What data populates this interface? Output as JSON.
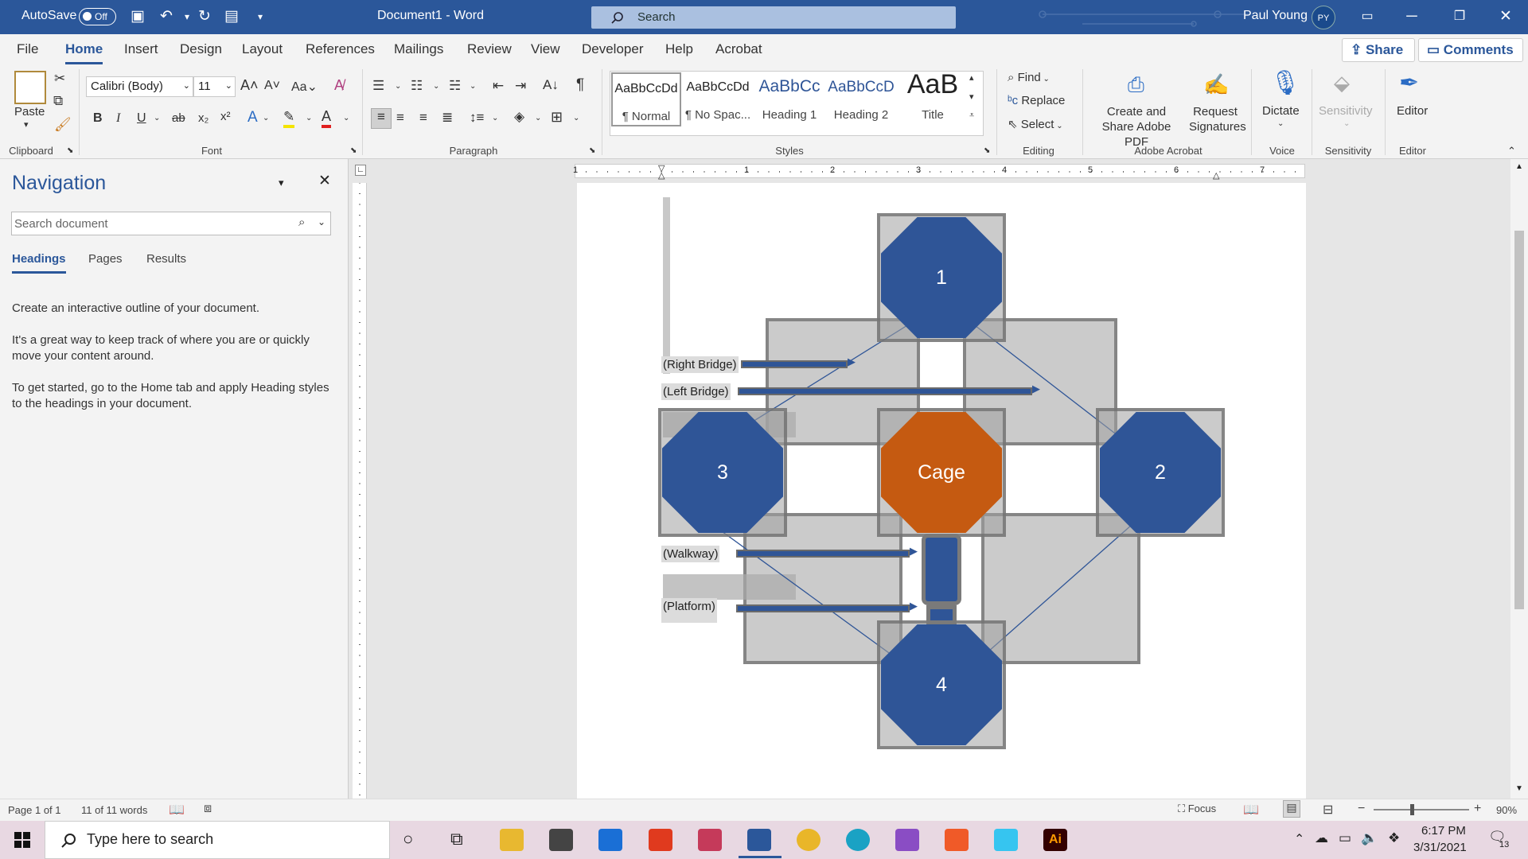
{
  "titlebar": {
    "autosave_label": "AutoSave",
    "autosave_state": "Off",
    "doc_title": "Document1 - Word",
    "search_placeholder": "Search",
    "user_name": "Paul Young",
    "user_initials": "PY"
  },
  "menu": {
    "items": [
      "File",
      "Home",
      "Insert",
      "Design",
      "Layout",
      "References",
      "Mailings",
      "Review",
      "View",
      "Developer",
      "Help",
      "Acrobat"
    ],
    "active": "Home",
    "share_label": "Share",
    "comments_label": "Comments"
  },
  "ribbon": {
    "clipboard": {
      "paste_label": "Paste",
      "group_label": "Clipboard"
    },
    "font": {
      "family": "Calibri (Body)",
      "size": "11",
      "group_label": "Font"
    },
    "paragraph": {
      "group_label": "Paragraph"
    },
    "styles": {
      "group_label": "Styles",
      "items": [
        {
          "preview": "AaBbCcDd",
          "name": "¶ Normal"
        },
        {
          "preview": "AaBbCcDd",
          "name": "¶ No Spac..."
        },
        {
          "preview": "AaBbCc",
          "name": "Heading 1"
        },
        {
          "preview": "AaBbCcD",
          "name": "Heading 2"
        },
        {
          "preview": "AaB",
          "name": "Title"
        }
      ]
    },
    "editing": {
      "find": "Find",
      "replace": "Replace",
      "select": "Select",
      "group_label": "Editing"
    },
    "acrobat": {
      "create_share": "Create and Share Adobe PDF",
      "request_sig": "Request Signatures",
      "group_label": "Adobe Acrobat"
    },
    "voice": {
      "dictate": "Dictate",
      "group_label": "Voice"
    },
    "sensitivity": {
      "label": "Sensitivity",
      "group_label": "Sensitivity"
    },
    "editor": {
      "label": "Editor",
      "group_label": "Editor"
    }
  },
  "navigation": {
    "title": "Navigation",
    "search_placeholder": "Search document",
    "tabs": [
      "Headings",
      "Pages",
      "Results"
    ],
    "active_tab": "Headings",
    "paragraphs": [
      "Create an interactive outline of your document.",
      "It's a great way to keep track of where you are or quickly move your content around.",
      "To get started, go to the Home tab and apply Heading styles to the headings in your document."
    ]
  },
  "ruler": {
    "h_numbers": [
      "1",
      "1",
      "2",
      "3",
      "4",
      "5",
      "6",
      "7"
    ]
  },
  "diagram": {
    "nodes": [
      "1",
      "2",
      "3",
      "Cage",
      "4"
    ],
    "labels": [
      "(Right Bridge)",
      "(Left Bridge)",
      "(Walkway)",
      "(Platform)"
    ],
    "colors": {
      "node_blue": "#2f5597",
      "cage_orange": "#c55a11"
    }
  },
  "status": {
    "page": "Page 1 of 1",
    "words": "11 of 11 words",
    "focus": "Focus",
    "zoom": "90%"
  },
  "taskbar": {
    "search_placeholder": "Type here to search",
    "time": "6:17 PM",
    "date": "3/31/2021",
    "notifications": "13"
  }
}
